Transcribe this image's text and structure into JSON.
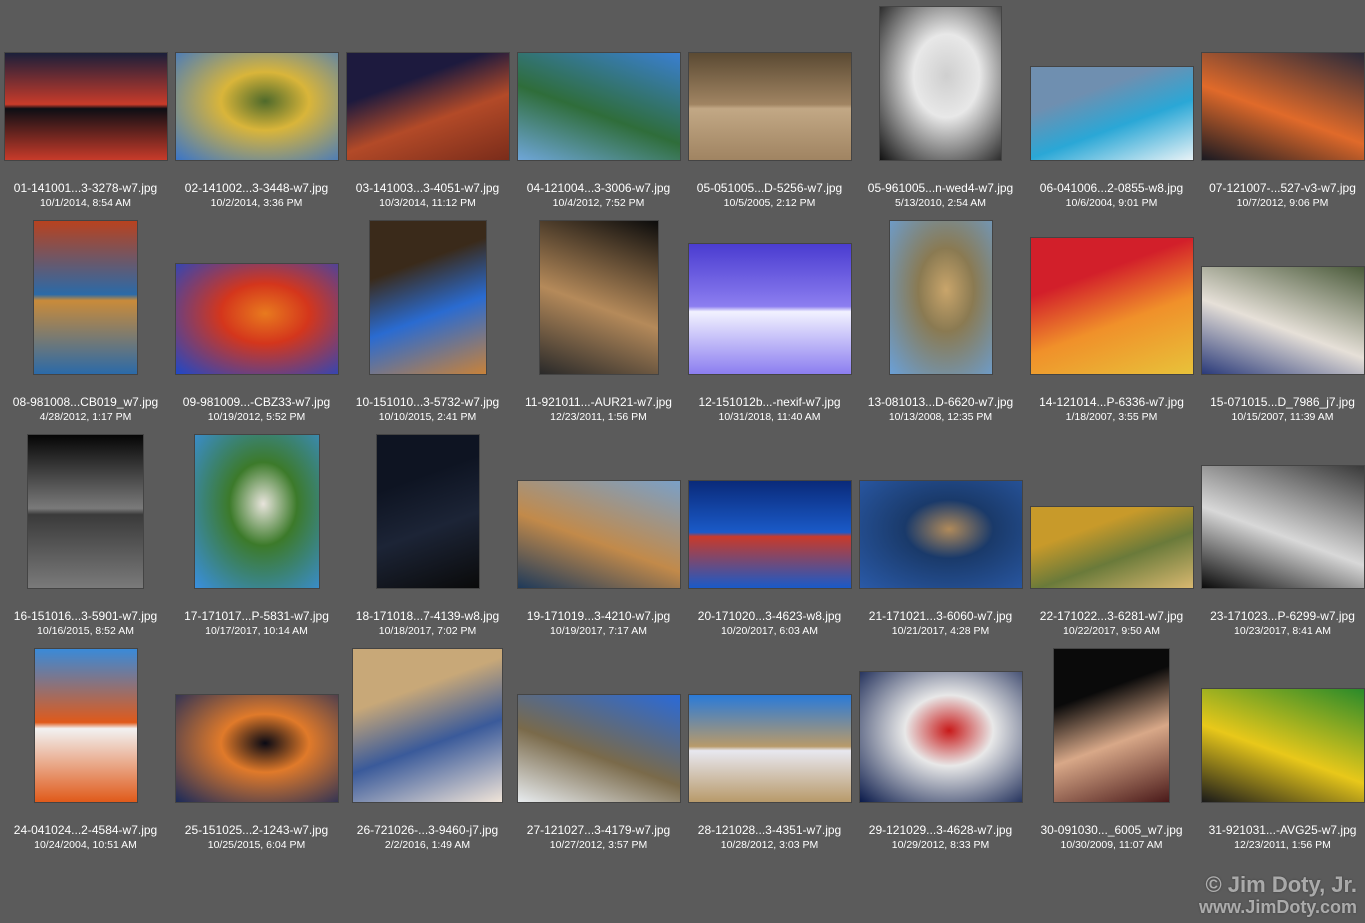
{
  "watermark": {
    "line1": "© Jim Doty, Jr.",
    "line2": "www.JimDoty.com"
  },
  "items": [
    {
      "name": "01-141001...3-3278-w7.jpg",
      "date": "10/1/2014, 8:54 AM",
      "colors": [
        "#1b1f3a",
        "#c83b2a",
        "#0d0e14"
      ],
      "subject": "sunset lake reflection"
    },
    {
      "name": "02-141002...3-3448-w7.jpg",
      "date": "10/2/2014, 3:36 PM",
      "colors": [
        "#3a75c8",
        "#d9b53a",
        "#4f6a2b"
      ],
      "subject": "aspens and mountain"
    },
    {
      "name": "03-141003...3-4051-w7.jpg",
      "date": "10/3/2014, 11:12 PM",
      "colors": [
        "#1d1a3e",
        "#b34a28",
        "#7a2c1a"
      ],
      "subject": "rock arch at night"
    },
    {
      "name": "04-121004...3-3006-w7.jpg",
      "date": "10/4/2012, 7:52 PM",
      "colors": [
        "#3a7fd1",
        "#2f6d3a",
        "#6fa6d8"
      ],
      "subject": "mountain lake reflection"
    },
    {
      "name": "05-051005...D-5256-w7.jpg",
      "date": "10/5/2005, 2:12 PM",
      "colors": [
        "#5b4a33",
        "#a08462",
        "#c2a885"
      ],
      "subject": "coyote"
    },
    {
      "name": "05-961005...n-wed4-w7.jpg",
      "date": "5/13/2010, 2:54 AM",
      "colors": [
        "#111111",
        "#e8e8e8",
        "#cfcfcf"
      ],
      "subject": "wedding portrait"
    },
    {
      "name": "06-041006...2-0855-w8.jpg",
      "date": "10/6/2004, 9:01 PM",
      "colors": [
        "#6f8fb0",
        "#2aa7d6",
        "#e8f2f6"
      ],
      "subject": "breaking wave"
    },
    {
      "name": "07-121007-...527-v3-w7.jpg",
      "date": "10/7/2012, 9:06 PM",
      "colors": [
        "#2a2a3a",
        "#e06a2a",
        "#1a1a22"
      ],
      "subject": "sunset lake"
    },
    {
      "name": "08-981008...CB019_w7.jpg",
      "date": "4/28/2012, 1:17 PM",
      "colors": [
        "#b8421f",
        "#2b6aa8",
        "#c98b3a"
      ],
      "subject": "autumn waterfall"
    },
    {
      "name": "09-981009...-CBZ33-w7.jpg",
      "date": "10/19/2012, 5:52 PM",
      "colors": [
        "#1e48c8",
        "#d4361c",
        "#e87a1e"
      ],
      "subject": "red maples and sky"
    },
    {
      "name": "10-151010...3-5732-w7.jpg",
      "date": "10/10/2015, 2:41 PM",
      "colors": [
        "#3a2a1a",
        "#2a6bd1",
        "#c8823a"
      ],
      "subject": "woman playing ukulele"
    },
    {
      "name": "11-921011...-AUR21-w7.jpg",
      "date": "12/23/2011, 1:56 PM",
      "colors": [
        "#0c0c0c",
        "#b58a5a",
        "#2a2a2a"
      ],
      "subject": "gymnast on beam"
    },
    {
      "name": "12-151012b...-nexif-w7.jpg",
      "date": "10/31/2018, 11:40 AM",
      "colors": [
        "#4a3cd0",
        "#8c7ef0",
        "#f2f2ff"
      ],
      "subject": "blue flower macro"
    },
    {
      "name": "13-081013...D-6620-w7.jpg",
      "date": "10/13/2008, 12:35 PM",
      "colors": [
        "#6aa0d8",
        "#8a7a52",
        "#c9a56b"
      ],
      "subject": "rocky shoreline lighthouse"
    },
    {
      "name": "14-121014...P-6336-w7.jpg",
      "date": "1/18/2007, 3:55 PM",
      "colors": [
        "#d21f2a",
        "#f0902a",
        "#e8c23a"
      ],
      "subject": "red leaves"
    },
    {
      "name": "15-071015...D_7986_j7.jpg",
      "date": "10/15/2007, 11:39 AM",
      "colors": [
        "#4a5a3a",
        "#e6e0d8",
        "#2a3a7a"
      ],
      "subject": "family group portrait"
    },
    {
      "name": "16-151016...3-5901-w7.jpg",
      "date": "10/16/2015, 8:52 AM",
      "colors": [
        "#050505",
        "#7a7a7a",
        "#3a3a3a"
      ],
      "subject": "silver body paint portrait"
    },
    {
      "name": "17-171017...P-5831-w7.jpg",
      "date": "10/17/2017, 10:14 AM",
      "colors": [
        "#3a8fe0",
        "#3c7a2a",
        "#e8e4dc"
      ],
      "subject": "white dog"
    },
    {
      "name": "18-171018...7-4139-w8.jpg",
      "date": "10/18/2017, 7:02 PM",
      "colors": [
        "#0e1422",
        "#1c2436",
        "#0a0a0a"
      ],
      "subject": "milky way night sky"
    },
    {
      "name": "19-171019...3-4210-w7.jpg",
      "date": "10/19/2017, 7:17 AM",
      "colors": [
        "#7aa0c8",
        "#c28a4a",
        "#1e3a5a"
      ],
      "subject": "rocky coast sunrise"
    },
    {
      "name": "20-171020...3-4623-w8.jpg",
      "date": "10/20/2017, 6:03 AM",
      "colors": [
        "#0a2a7a",
        "#1a5ac8",
        "#c83a2a"
      ],
      "subject": "night fisheye sky"
    },
    {
      "name": "21-171021...3-6060-w7.jpg",
      "date": "10/21/2017, 4:28 PM",
      "colors": [
        "#2a5aa8",
        "#1a3a6a",
        "#b08a5a"
      ],
      "subject": "pond with boulders"
    },
    {
      "name": "22-171022...3-6281-w7.jpg",
      "date": "10/22/2017, 9:50 AM",
      "colors": [
        "#c89a2a",
        "#6a7a3a",
        "#d8b870"
      ],
      "subject": "boardwalk autumn forest"
    },
    {
      "name": "23-171023...P-6299-w7.jpg",
      "date": "10/23/2017, 8:41 AM",
      "colors": [
        "#3a3a3a",
        "#d8d8d8",
        "#0a0a0a"
      ],
      "subject": "black and white storm clouds"
    },
    {
      "name": "24-041024...2-4584-w7.jpg",
      "date": "10/24/2004, 10:51 AM",
      "colors": [
        "#3a8ad8",
        "#e05a1a",
        "#f2f2f2"
      ],
      "subject": "white church autumn"
    },
    {
      "name": "25-151025...2-1243-w7.jpg",
      "date": "10/25/2015, 6:04 PM",
      "colors": [
        "#1a2a5a",
        "#e07a2a",
        "#0a0a14"
      ],
      "subject": "reflection in stream"
    },
    {
      "name": "26-721026-...3-9460-j7.jpg",
      "date": "2/2/2016, 1:49 AM",
      "colors": [
        "#c8a878",
        "#3a5a9a",
        "#f0e4d8"
      ],
      "subject": "father holding baby"
    },
    {
      "name": "27-121027...3-4179-w7.jpg",
      "date": "10/27/2012, 3:57 PM",
      "colors": [
        "#2a6ad8",
        "#7a6a4a",
        "#e8ecef"
      ],
      "subject": "couple in mountains"
    },
    {
      "name": "28-121028...3-4351-w7.jpg",
      "date": "10/28/2012, 3:03 PM",
      "colors": [
        "#2a7ad8",
        "#b89a6a",
        "#e8e8f0"
      ],
      "subject": "road to mountains"
    },
    {
      "name": "29-121029...3-4628-w7.jpg",
      "date": "10/29/2012, 8:33 PM",
      "colors": [
        "#0a1a4a",
        "#e8e8e8",
        "#c81a1a"
      ],
      "subject": "elk at storefront"
    },
    {
      "name": "30-091030..._6005_w7.jpg",
      "date": "10/30/2009, 11:07 AM",
      "colors": [
        "#0a0a0a",
        "#d8a888",
        "#4a1a1a"
      ],
      "subject": "woman portrait"
    },
    {
      "name": "31-921031...-AVG25-w7.jpg",
      "date": "12/23/2011, 1:56 PM",
      "colors": [
        "#2a8a2a",
        "#e8c81a",
        "#1a1a1a"
      ],
      "subject": "football game"
    }
  ]
}
